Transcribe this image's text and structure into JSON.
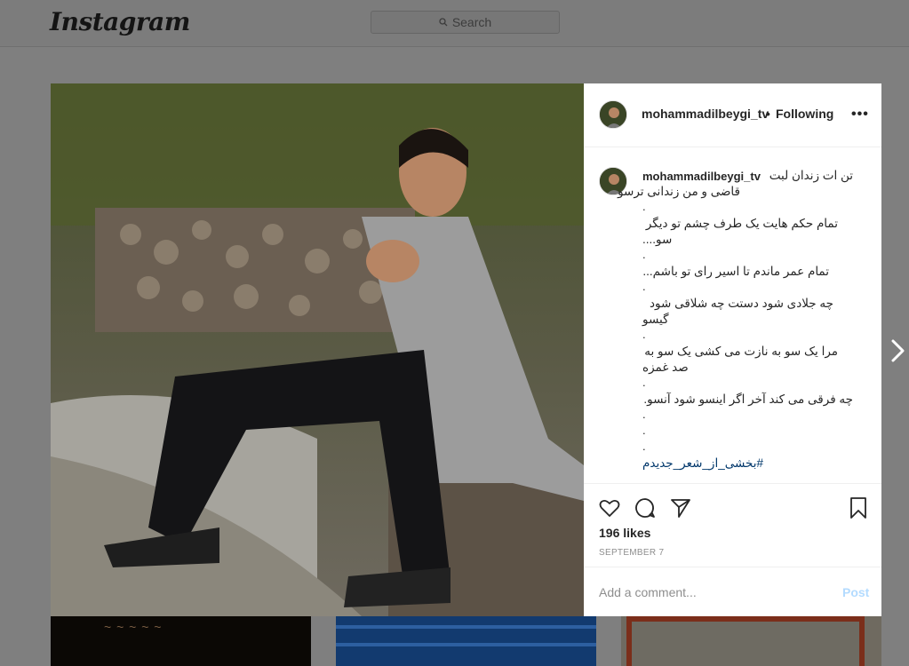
{
  "topbar": {
    "logo_text": "Instagram",
    "search_placeholder": "Search"
  },
  "post": {
    "username": "mohammadilbeygi_tv",
    "separator": "•",
    "follow_status": "Following",
    "more_label": "•••",
    "caption": {
      "username": "mohammadilbeygi_tv",
      "lines": [
        "تن ات زندان لبت",
        "قاضی و من زندانی ترسو",
        ".",
        "تمام حکم هایت یک طرف چشم تو دیگر",
        "سو....",
        ".",
        "تمام عمر ماندم تا اسیر رای تو باشم...",
        ".",
        "چه جلادی شود دستت چه شلاقی شود",
        "گیسو",
        ".",
        "مرا یک سو به نازت می کشی یک سو به",
        "صد غمزه",
        ".",
        "چه فرقی می کند آخر اگر اینسو شود آنسو.",
        ".",
        ".",
        "."
      ],
      "hashtag": "#بخشی_از_شعر_جدیدم"
    },
    "likes": "196 likes",
    "date": "SEPTEMBER 7",
    "comment_placeholder": "Add a comment...",
    "post_label": "Post"
  },
  "icons": {
    "like": "heart-icon",
    "comment": "comment-icon",
    "share": "share-icon",
    "save": "bookmark-icon",
    "next": "chevron-right-icon",
    "search": "search-icon"
  },
  "colors": {
    "overlay_bg": "#7f7f7f",
    "link": "#00376b",
    "post_button": "#b3dbff",
    "meta_text": "#8e8e8e"
  }
}
